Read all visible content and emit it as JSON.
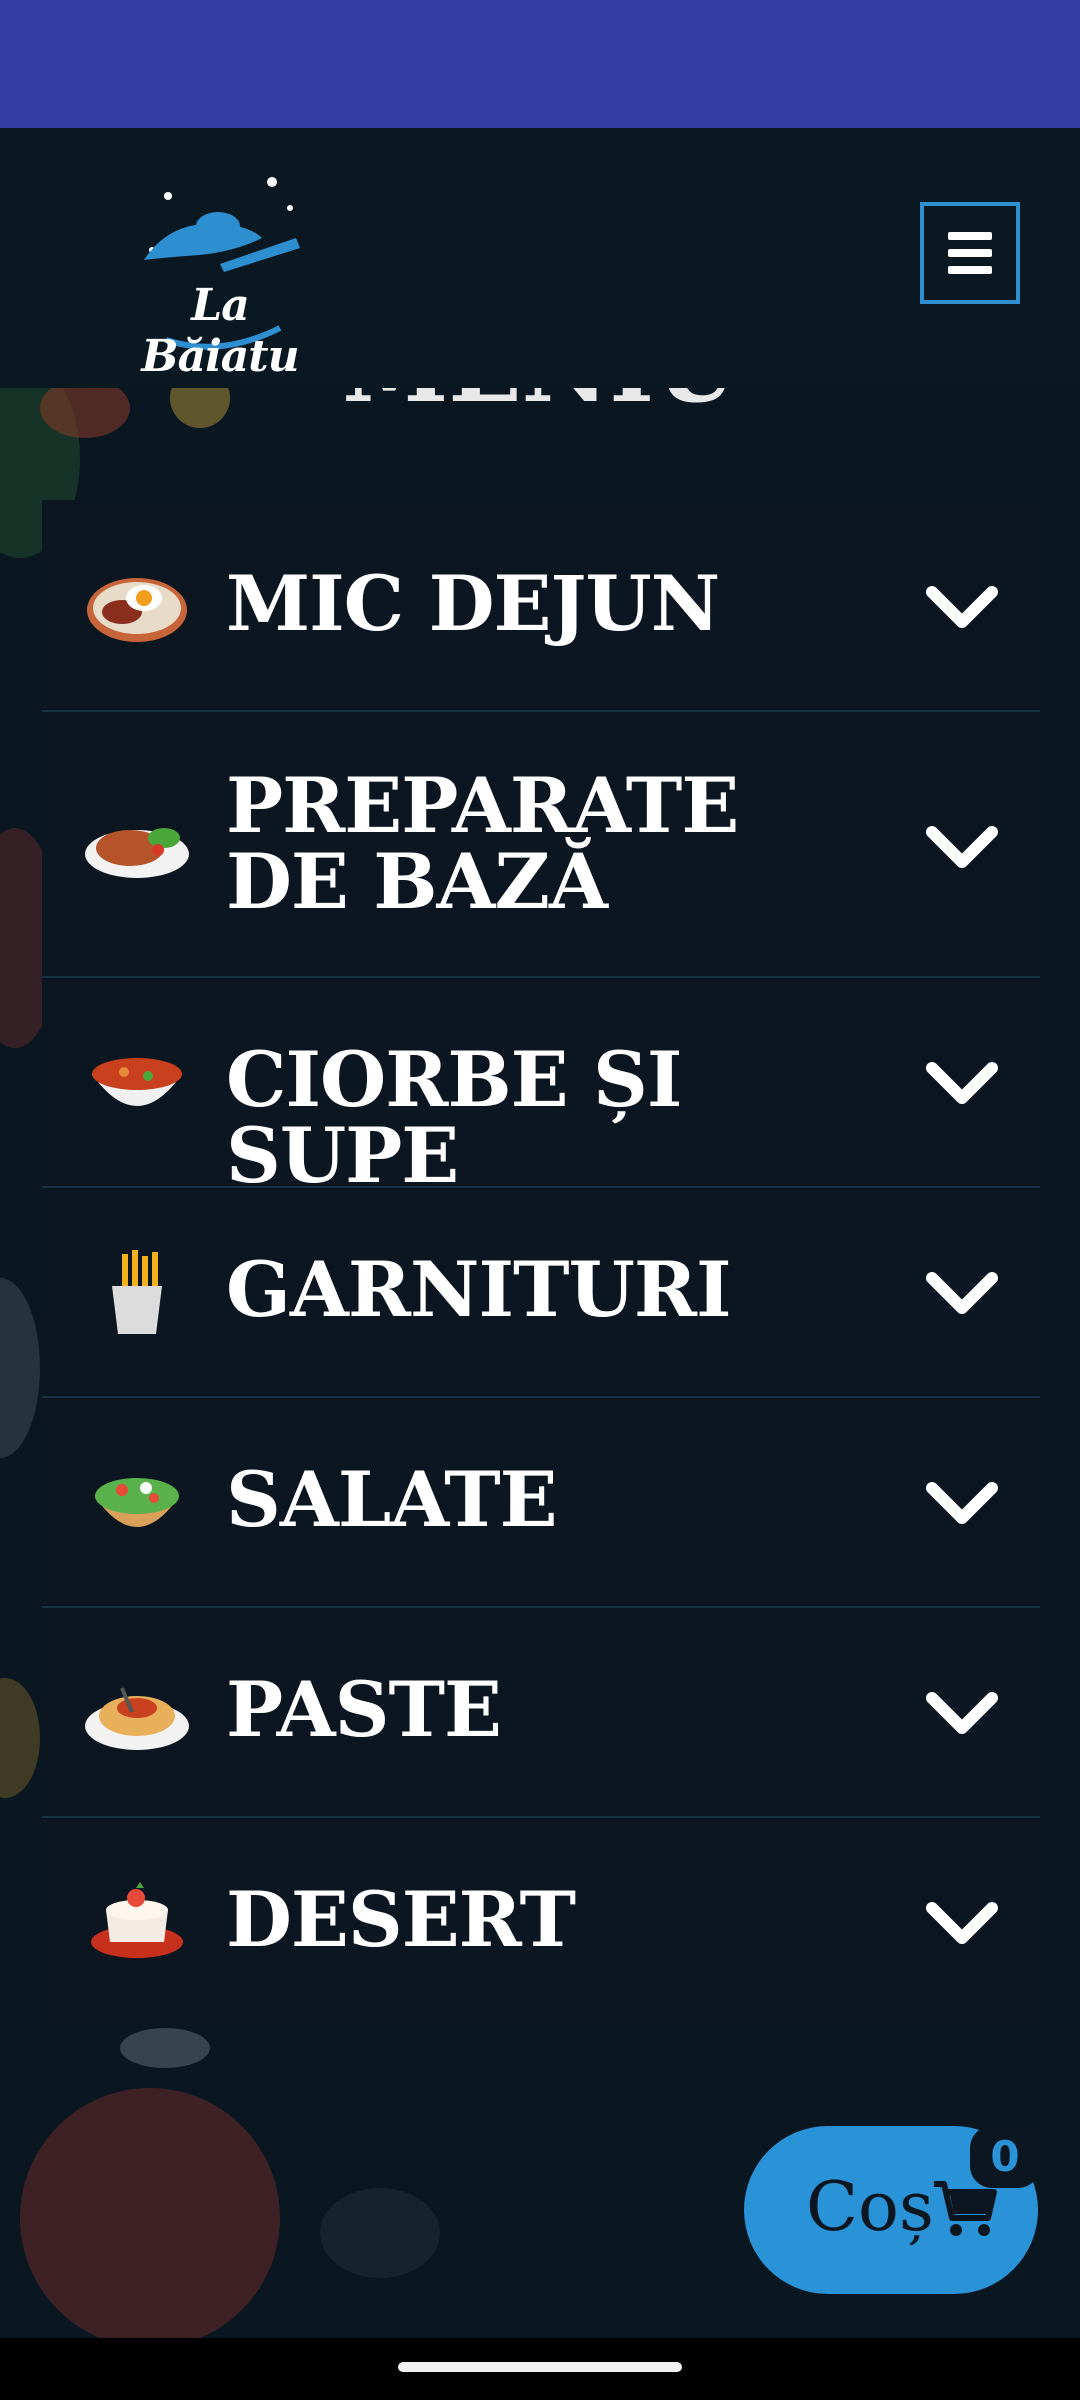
{
  "header": {
    "logo_text": "La Băiatu",
    "menu_icon": "hamburger-menu-icon"
  },
  "section_title": "MENIU",
  "accordion": {
    "items": [
      {
        "label": "MIC DEJUN",
        "icon": "breakfast-icon"
      },
      {
        "label": "PREPARATE DE BAZĂ",
        "icon": "main-course-icon"
      },
      {
        "label": "CIORBE ȘI SUPE",
        "icon": "soup-bowl-icon"
      },
      {
        "label": "GARNITURI",
        "icon": "fries-icon"
      },
      {
        "label": "SALATE",
        "icon": "salad-icon"
      },
      {
        "label": "PASTE",
        "icon": "pasta-icon"
      },
      {
        "label": "DESERT",
        "icon": "dessert-icon"
      }
    ],
    "chevron_icon": "chevron-down-icon"
  },
  "cart": {
    "label": "Coș",
    "count": "0",
    "icon": "shopping-cart-icon"
  },
  "colors": {
    "status_bar": "#323ea1",
    "header_bg": "#0a1921",
    "accent": "#2a93d8",
    "panel_bg": "#0b1620"
  }
}
